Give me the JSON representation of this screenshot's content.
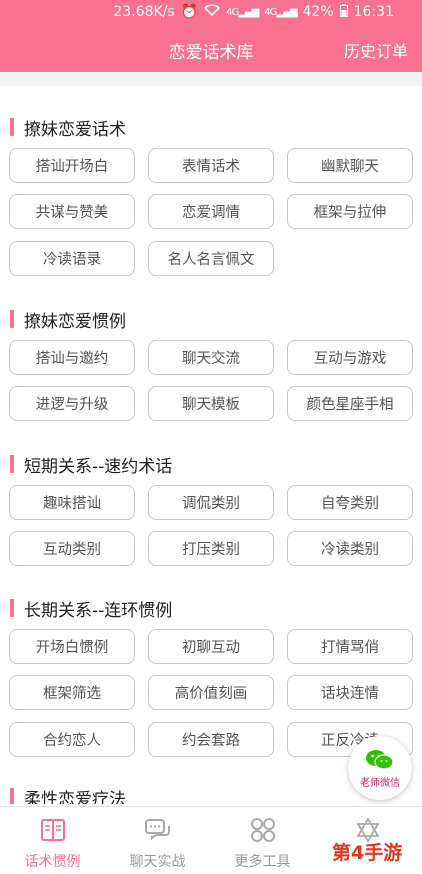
{
  "status_bar": {
    "speed": "23.68K/s",
    "signal1": "4G",
    "signal2": "4G",
    "battery": "42%",
    "time": "16:31"
  },
  "header": {
    "title": "恋爱话术库",
    "right_label": "历史订单"
  },
  "sections": [
    {
      "title": "撩妹恋爱话术",
      "items": [
        "搭讪开场白",
        "表情话术",
        "幽默聊天",
        "共谋与赞美",
        "恋爱调情",
        "框架与拉伸",
        "冷读语录",
        "名人名言佩文"
      ]
    },
    {
      "title": "撩妹恋爱惯例",
      "items": [
        "搭讪与邀约",
        "聊天交流",
        "互动与游戏",
        "进逻与升级",
        "聊天模板",
        "颜色星座手相"
      ]
    },
    {
      "title": "短期关系--速约术话",
      "items": [
        "趣味搭讪",
        "调侃类别",
        "自夸类别",
        "互动类别",
        "打压类别",
        "冷读类别"
      ]
    },
    {
      "title": "长期关系--连环惯例",
      "items": [
        "开场白惯例",
        "初聊互动",
        "打情骂俏",
        "框架筛选",
        "高价值刻画",
        "话块连情",
        "合约恋人",
        "约会套路",
        "正反冷读"
      ]
    },
    {
      "title": "柔性恋爱疗法",
      "items": []
    }
  ],
  "fab": {
    "label": "老师微信",
    "icon": "wechat-icon"
  },
  "tabs": [
    {
      "label": "话术惯例",
      "icon": "book-icon",
      "active": true
    },
    {
      "label": "聊天实战",
      "icon": "chat-icon",
      "active": false
    },
    {
      "label": "更多工具",
      "icon": "grid-icon",
      "active": false
    },
    {
      "label": "",
      "icon": "star-of-david-icon",
      "active": false
    }
  ],
  "watermark": "第4手游",
  "colors": {
    "accent": "#f8728f",
    "tag_border": "#c8c8c8",
    "tab_inactive": "#999999"
  }
}
